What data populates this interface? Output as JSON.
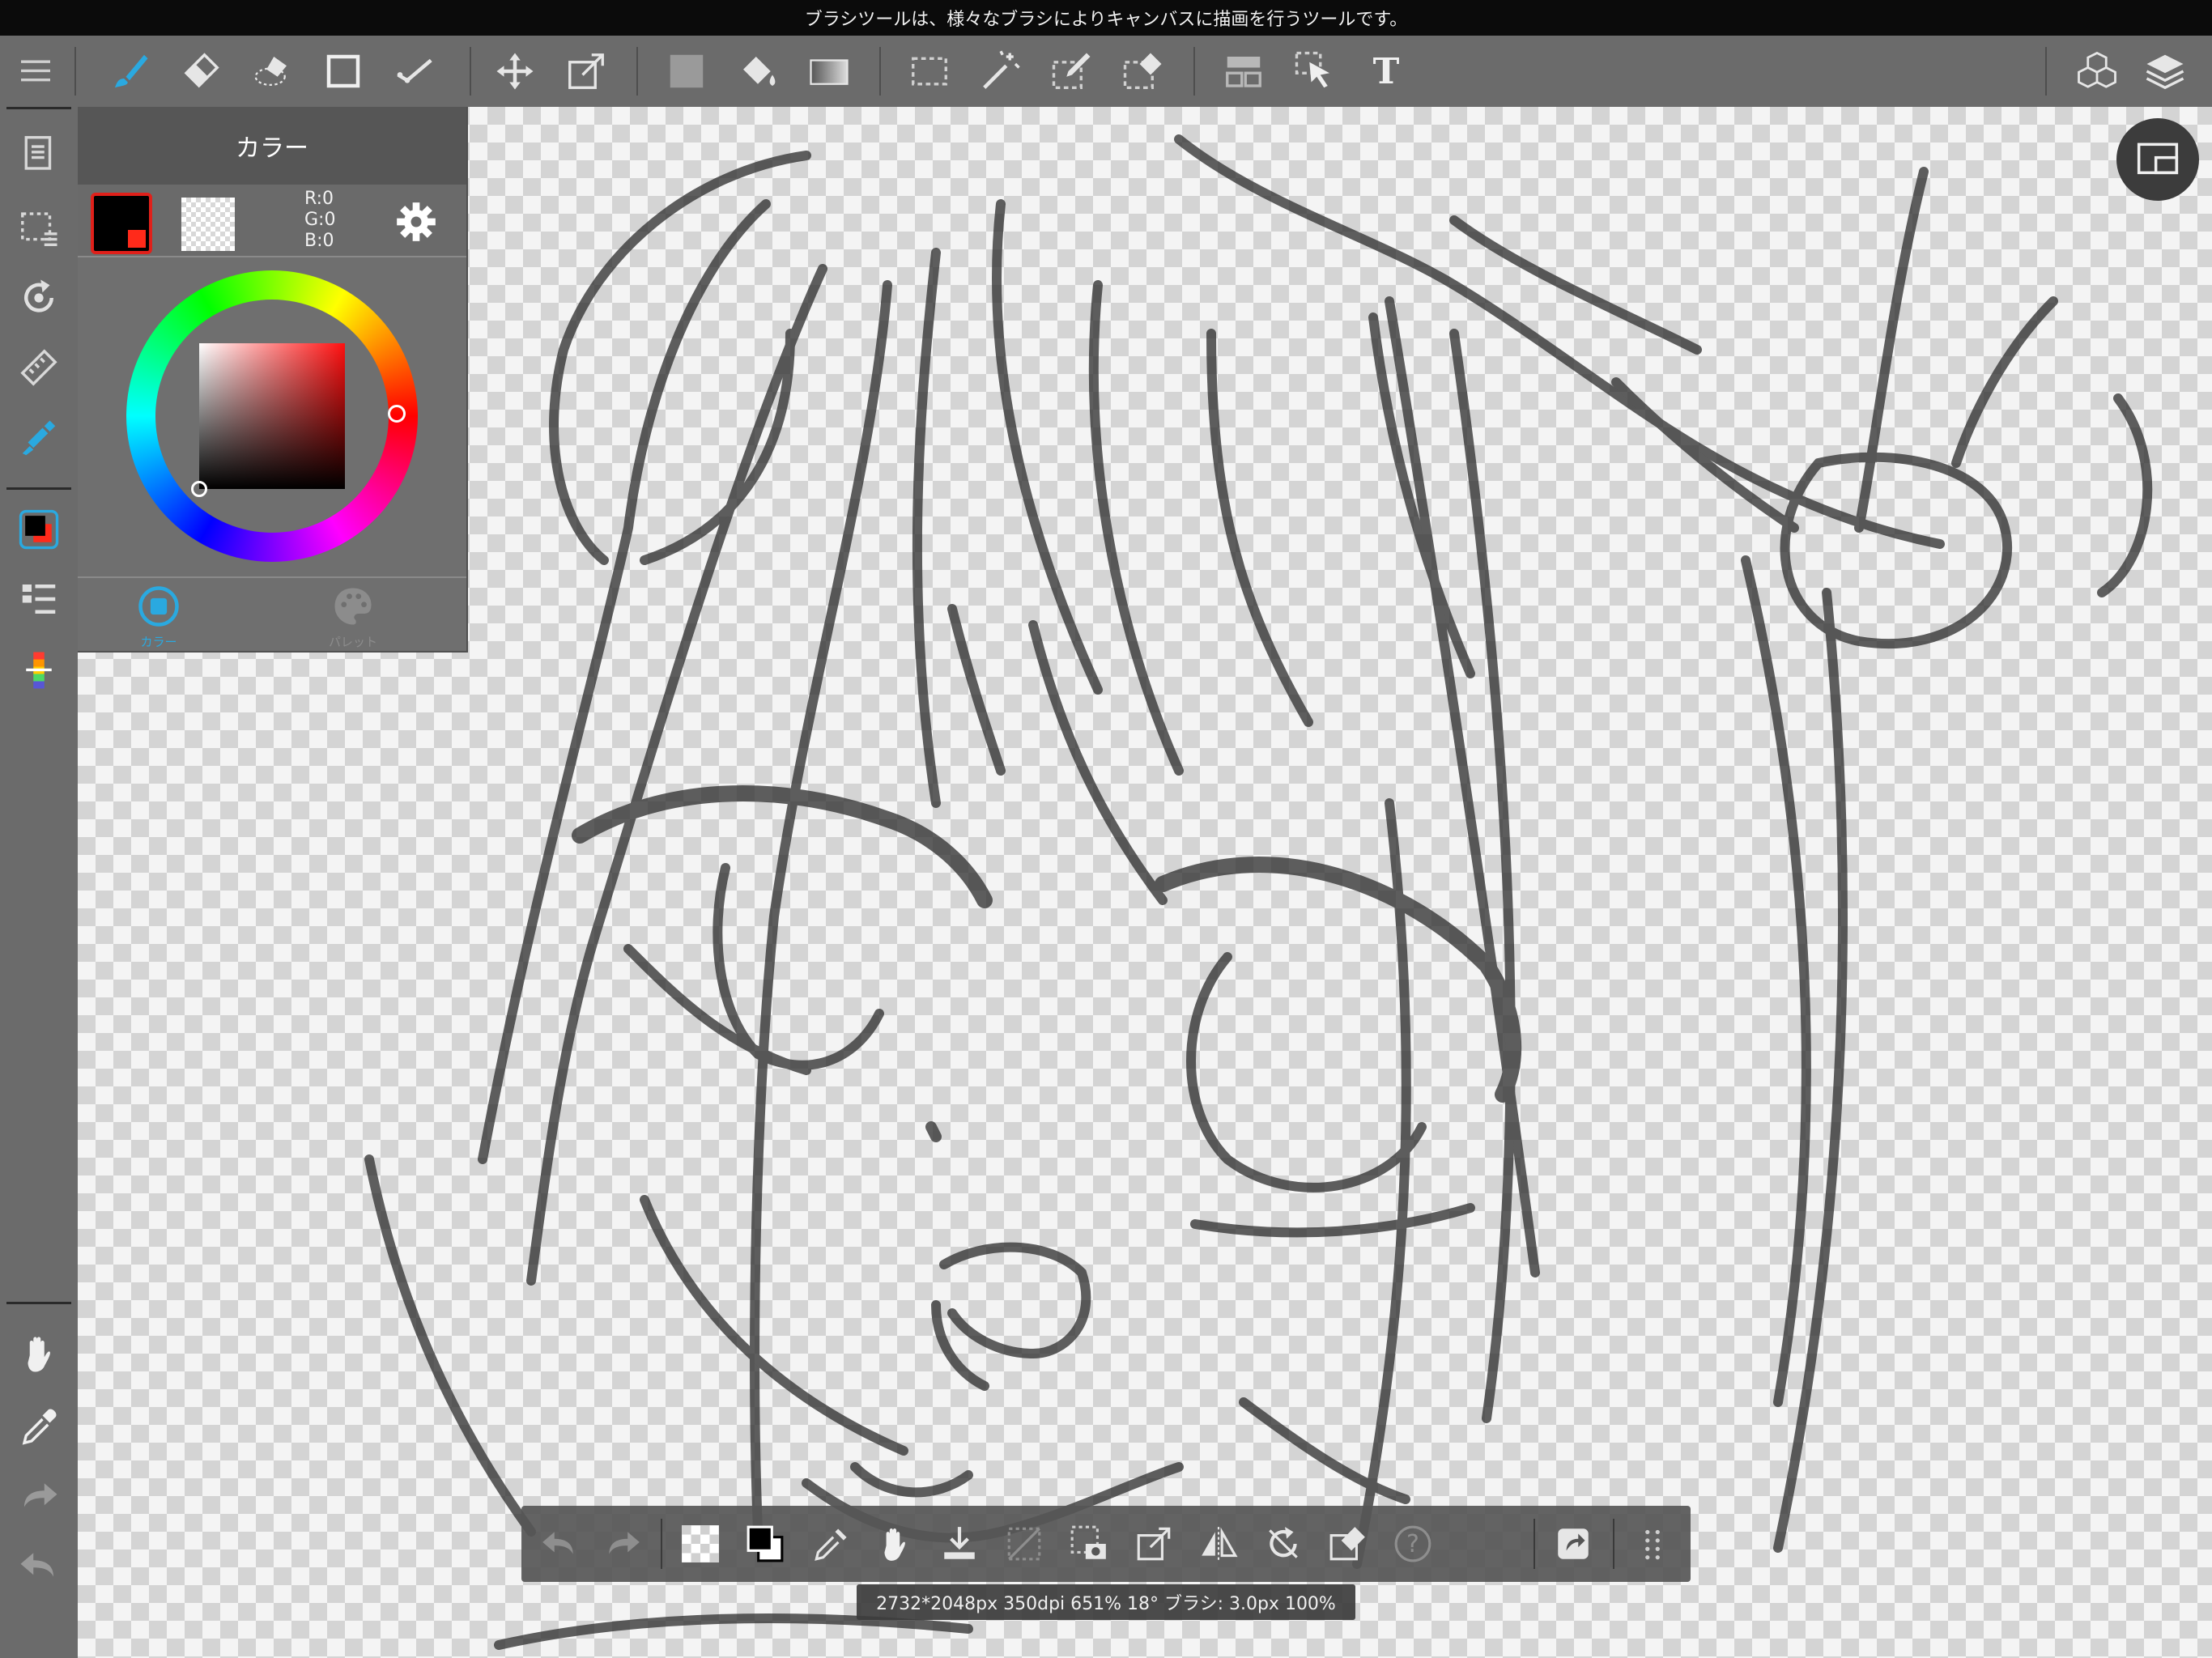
{
  "hint_bar": {
    "text": "ブラシツールは、様々なブラシによりキャンバスに描画を行うツールです。"
  },
  "top_toolbar": {
    "tools": [
      "menu-icon",
      "brush-icon",
      "eraser-icon",
      "blur-eraser-icon",
      "shape-icon",
      "fill-line-icon",
      "move-icon",
      "transform-icon",
      "fill-color-icon",
      "bucket-icon",
      "gradient-icon",
      "select-rect-icon",
      "magic-wand-icon",
      "select-pen-icon",
      "select-eraser-icon",
      "panel-layout-icon",
      "operation-icon",
      "text-icon",
      "material-icon",
      "layers-icon"
    ],
    "text_tool_label": "T"
  },
  "color_panel": {
    "title": "カラー",
    "rgb": {
      "r": "R:0",
      "g": "G:0",
      "b": "B:0"
    },
    "foreground": "#000000",
    "foreground_secondary": "#ff2a1a",
    "tabs": {
      "color": "カラー",
      "palette": "パレット"
    }
  },
  "left_rail": {
    "items": [
      "page-icon",
      "selection-icon",
      "rotate-icon",
      "ruler-icon",
      "brush-color-icon",
      "color-icon",
      "layer-list-icon",
      "palette-strip-icon",
      "hand-icon",
      "eyedropper-icon",
      "redo-icon",
      "undo-icon"
    ]
  },
  "bottom_toolbar": {
    "tools": [
      "undo-icon",
      "redo-icon",
      "transparent-icon",
      "color-swap-icon",
      "eyedropper-icon",
      "hand-icon",
      "download-icon",
      "deselect-icon",
      "snapshot-icon",
      "transform-icon",
      "flip-icon",
      "rotate-reset-icon",
      "edit-icon",
      "help-icon",
      "share-icon",
      "grip-icon"
    ],
    "help_label": "?"
  },
  "canvas_info": {
    "text": "2732*2048px 350dpi 651% 18° ブラシ: 3.0px 100%"
  },
  "colors": {
    "toolbar_bg": "#6b6b6b",
    "accent_blue": "#2aa9e0",
    "hint_bg": "#0b0b0b"
  }
}
